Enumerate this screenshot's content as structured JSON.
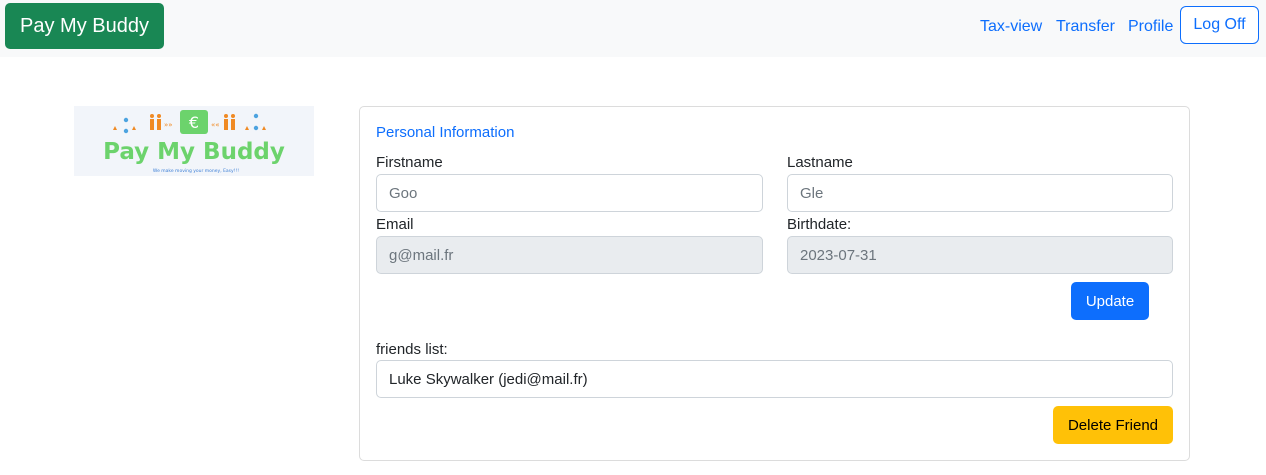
{
  "navbar": {
    "brand": "Pay My Buddy",
    "links": [
      "Tax-view",
      "Transfer",
      "Profile"
    ],
    "logoff": "Log Off"
  },
  "logo": {
    "title": "Pay My Buddy",
    "tagline": "We make moving your money, Easy!!!",
    "euro": "€"
  },
  "personal": {
    "title": "Personal Information",
    "firstname_label": "Firstname",
    "firstname_value": "Goo",
    "lastname_label": "Lastname",
    "lastname_value": "Gle",
    "email_label": "Email",
    "email_value": "g@mail.fr",
    "birthdate_label": "Birthdate:",
    "birthdate_value": "2023-07-31",
    "update_label": "Update"
  },
  "friends": {
    "label": "friends list:",
    "selected": "Luke Skywalker (jedi@mail.fr)",
    "delete_label": "Delete Friend"
  },
  "colors": {
    "brand_bg": "#198754",
    "primary": "#0d6efd",
    "warning": "#ffc107",
    "logo_green": "#6cd36c",
    "logo_orange": "#f08a24"
  }
}
